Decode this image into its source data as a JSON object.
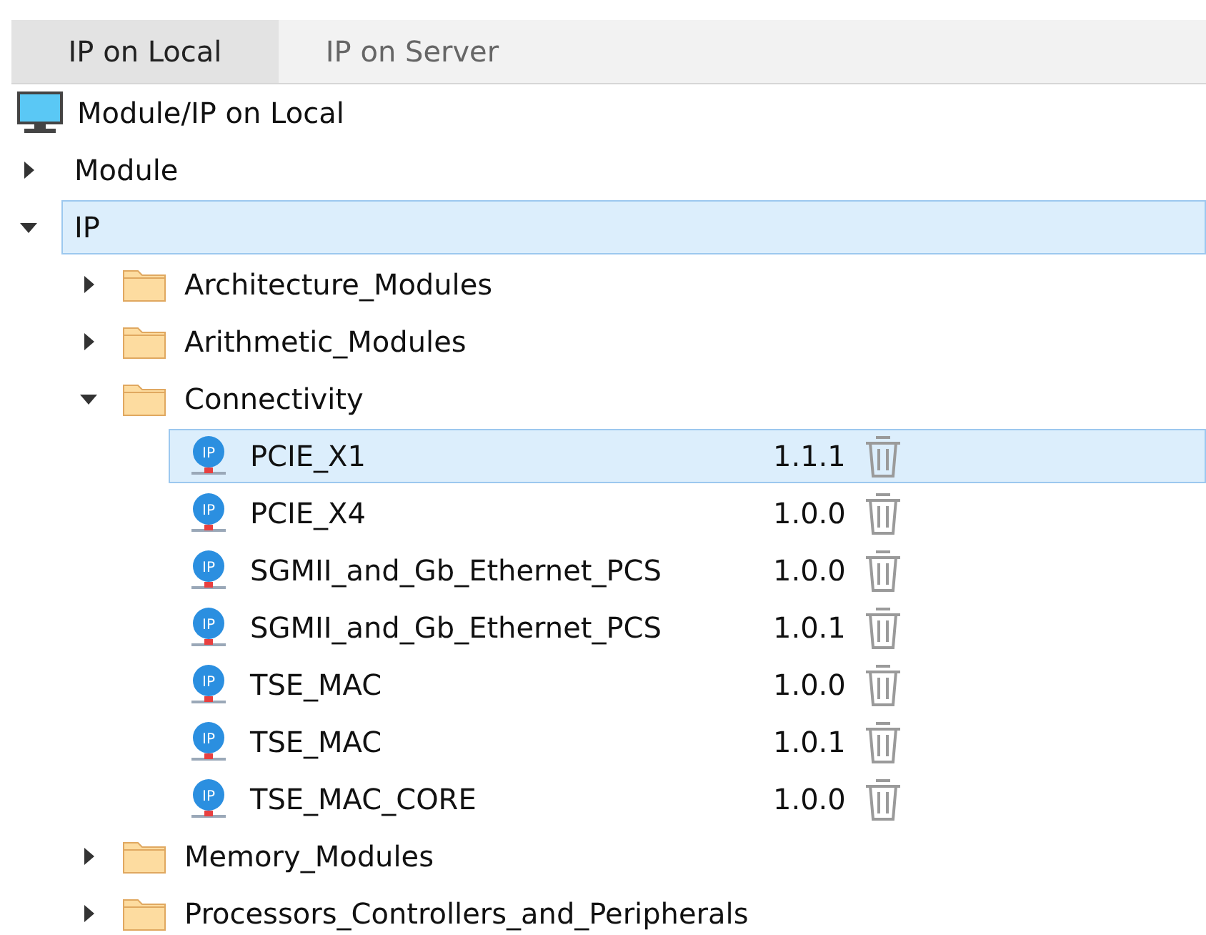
{
  "tabs": [
    {
      "label": "IP on Local",
      "selected": true
    },
    {
      "label": "IP on Server",
      "selected": false
    }
  ],
  "tree": {
    "root": {
      "label": "Module/IP on Local"
    },
    "items": [
      {
        "kind": "category",
        "label": "Module",
        "expanded": false,
        "selected": false
      },
      {
        "kind": "category",
        "label": "IP",
        "expanded": true,
        "selected": true,
        "children": [
          {
            "kind": "folder",
            "label": "Architecture_Modules",
            "expanded": false,
            "selected": false
          },
          {
            "kind": "folder",
            "label": "Arithmetic_Modules",
            "expanded": false,
            "selected": false
          },
          {
            "kind": "folder",
            "label": "Connectivity",
            "expanded": true,
            "selected": false,
            "children": [
              {
                "kind": "ip",
                "badge": "IP",
                "label": "PCIE_X1",
                "version": "1.1.1",
                "selected": true
              },
              {
                "kind": "ip",
                "badge": "IP",
                "label": "PCIE_X4",
                "version": "1.0.0",
                "selected": false
              },
              {
                "kind": "ip",
                "badge": "IP",
                "label": "SGMII_and_Gb_Ethernet_PCS",
                "version": "1.0.0",
                "selected": false
              },
              {
                "kind": "ip",
                "badge": "IP",
                "label": "SGMII_and_Gb_Ethernet_PCS",
                "version": "1.0.1",
                "selected": false
              },
              {
                "kind": "ip",
                "badge": "IP",
                "label": "TSE_MAC",
                "version": "1.0.0",
                "selected": false
              },
              {
                "kind": "ip",
                "badge": "IP",
                "label": "TSE_MAC",
                "version": "1.0.1",
                "selected": false
              },
              {
                "kind": "ip",
                "badge": "IP",
                "label": "TSE_MAC_CORE",
                "version": "1.0.0",
                "selected": false
              }
            ]
          },
          {
            "kind": "folder",
            "label": "Memory_Modules",
            "expanded": false,
            "selected": false
          },
          {
            "kind": "folder",
            "label": "Processors_Controllers_and_Peripherals",
            "expanded": false,
            "selected": false
          }
        ]
      }
    ]
  }
}
